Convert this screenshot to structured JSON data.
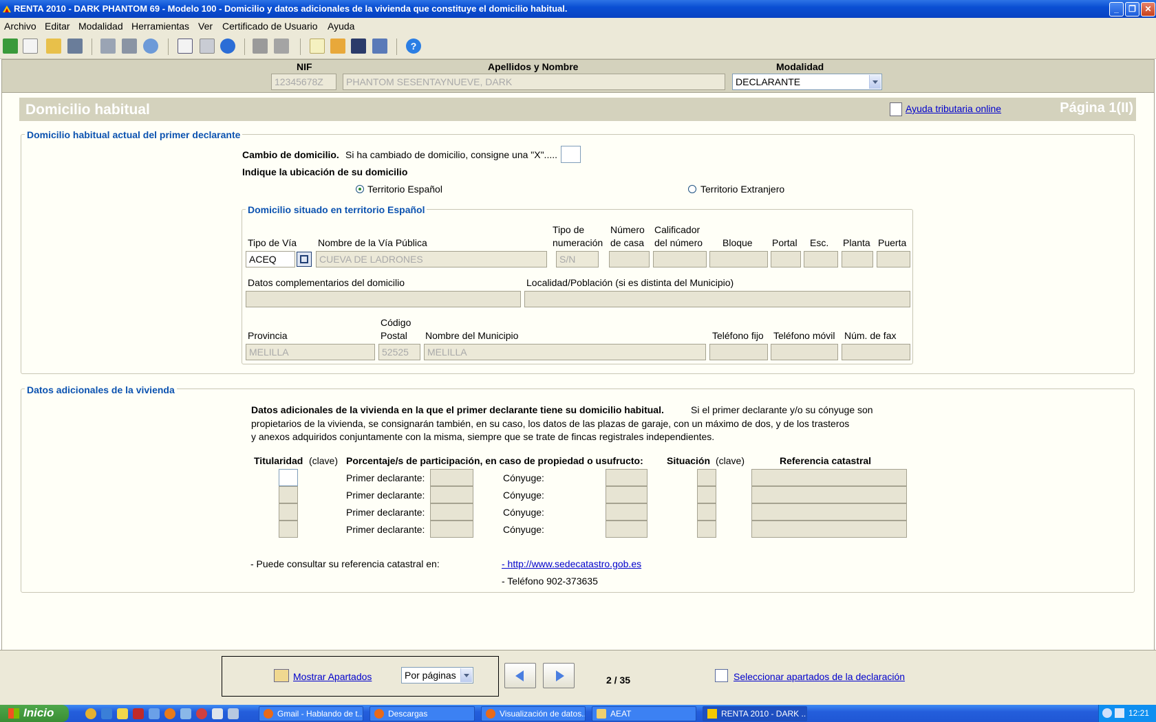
{
  "window": {
    "title": "RENTA 2010 - DARK PHANTOM 69 - Modelo 100 - Domicilio y datos adicionales de la vivienda que constituye el domicilio habitual."
  },
  "menu": [
    "Archivo",
    "Editar",
    "Modalidad",
    "Herramientas",
    "Ver",
    "Certificado de Usuario",
    "Ayuda"
  ],
  "header": {
    "nif_label": "NIF",
    "nif_value": "12345678Z",
    "name_label": "Apellidos y Nombre",
    "name_value": "PHANTOM SESENTAYNUEVE, DARK",
    "modalidad_label": "Modalidad",
    "modalidad_value": "DECLARANTE"
  },
  "section": {
    "title": "Domicilio habitual",
    "help_link": "Ayuda tributaria online",
    "page": "Página 1(II)"
  },
  "domicilio": {
    "group_title": "Domicilio habitual actual del primer declarante",
    "cambio_bold": "Cambio de domicilio.",
    "cambio_text": "Si ha cambiado de domicilio, consigne una \"X\".....",
    "ubicacion_label": "Indique la ubicación de su domicilio",
    "radio_es": "Territorio Español",
    "radio_ext": "Territorio Extranjero",
    "selected": "Territorio Español",
    "subgroup_title": "Domicilio situado en territorio Español",
    "labels": {
      "tipo_via": "Tipo de Vía",
      "nombre_via": "Nombre de la Vía Pública",
      "tipo_num_1": "Tipo de",
      "tipo_num_2": "numeración",
      "num_casa_1": "Número",
      "num_casa_2": "de casa",
      "calif_1": "Calificador",
      "calif_2": "del número",
      "bloque": "Bloque",
      "portal": "Portal",
      "esc": "Esc.",
      "planta": "Planta",
      "puerta": "Puerta",
      "datos_comp": "Datos complementarios del domicilio",
      "localidad": "Localidad/Población (si es distinta del Municipio)",
      "provincia": "Provincia",
      "cp_1": "Código",
      "cp_2": "Postal",
      "municipio": "Nombre del Municipio",
      "tel_fijo": "Teléfono fijo",
      "tel_movil": "Teléfono móvil",
      "fax": "Núm. de fax"
    },
    "values": {
      "tipo_via": "ACEQ",
      "nombre_via": "CUEVA DE LADRONES",
      "tipo_num": "S/N",
      "provincia": "MELILLA",
      "cp": "52525",
      "municipio": "MELILLA"
    }
  },
  "vivienda": {
    "group_title": "Datos adicionales de la vivienda",
    "intro_bold": "Datos adicionales de la vivienda en la que el primer declarante tiene su domicilio habitual.",
    "intro_1": "Si el primer declarante y/o su cónyuge son",
    "intro_2": "propietarios de la vivienda, se consignarán también, en su caso, los datos de las plazas de garaje, con un máximo de dos, y de los trasteros",
    "intro_3": "y anexos adquiridos conjuntamente con la misma, siempre que se trate de fincas registrales independientes.",
    "col_titularidad": "Titularidad",
    "col_clave": "(clave)",
    "col_porcentaje": "Porcentaje/s de participación, en caso de propiedad o usufructo:",
    "col_situacion": "Situación",
    "col_clave2": "(clave)",
    "col_referencia": "Referencia catastral",
    "row_primer": "Primer declarante:",
    "row_conyuge": "Cónyuge:",
    "rows": 4,
    "consulta": "- Puede consultar su referencia catastral en:",
    "url": "- http://www.sedecatastro.gob.es",
    "telefono": "- Teléfono 902-373635"
  },
  "nav": {
    "mostrar": "Mostrar Apartados",
    "paginacion": "Por páginas",
    "page_counter": "2 / 35",
    "seleccionar": "Seleccionar apartados de la declaración"
  },
  "taskbar": {
    "start": "Inicio",
    "tasks": [
      "Gmail - Hablando de t...",
      "Descargas",
      "Visualización de datos...",
      "AEAT",
      "RENTA 2010 - DARK ..."
    ],
    "clock": "12:21"
  },
  "colors": {
    "accent_blue": "#0b52b0",
    "panel": "#d4d2bd",
    "titlebar": "#0a4fd3"
  }
}
